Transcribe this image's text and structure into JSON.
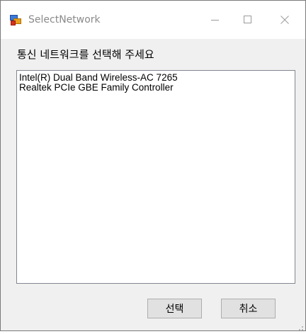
{
  "window": {
    "title": "SelectNetwork",
    "icons": {
      "app": "app-window-icon",
      "minimize": "minimize-icon",
      "maximize": "maximize-icon",
      "close": "close-icon"
    }
  },
  "dialog": {
    "prompt": "통신 네트워크를 선택해 주세요",
    "network_list": [
      "Intel(R) Dual Band Wireless-AC 7265",
      "Realtek PCIe GBE Family Controller"
    ],
    "buttons": {
      "select_label": "선택",
      "cancel_label": "취소"
    }
  },
  "colors": {
    "window_bg": "#f0f0f0",
    "titlebar_bg": "#ffffff",
    "title_text": "#8a8a8a",
    "button_bg": "#e1e1e1",
    "button_border": "#adadad",
    "list_border": "#828790"
  }
}
